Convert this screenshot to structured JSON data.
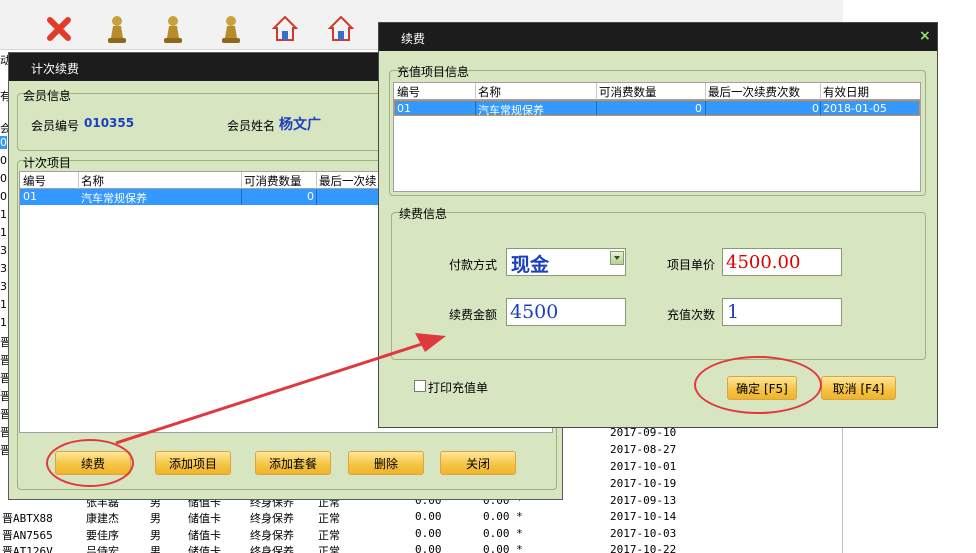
{
  "background": {
    "left_labels": [
      "动",
      "有",
      "会",
      "0",
      "0",
      "0",
      "0",
      "1",
      "1",
      "3",
      "3",
      "3",
      "1",
      "1",
      "晋",
      "晋",
      "晋",
      "晋",
      "晋",
      "晋",
      "晋"
    ],
    "rows": [
      {
        "plate": "晋ABTX88",
        "name": "康建杰",
        "sex": "男",
        "card": "储值卡",
        "plan": "终身保养",
        "status": "正常",
        "v1": "0.00",
        "v2": "0.00 *",
        "date": "2017-10-14"
      },
      {
        "plate": "晋AN7565",
        "name": "要佳序",
        "sex": "男",
        "card": "储值卡",
        "plan": "终身保养",
        "status": "正常",
        "v1": "0.00",
        "v2": "0.00 *",
        "date": "2017-10-03"
      },
      {
        "plate": "晋AT126V",
        "name": "吕侍宏",
        "sex": "男",
        "card": "储值卡",
        "plan": "终身保养",
        "status": "正常",
        "v1": "0.00",
        "v2": "0.00 *",
        "date": "2017-10-22"
      }
    ],
    "dates_right": [
      "2017-09-10",
      "2017-08-27",
      "2017-10-01",
      "2017-10-19",
      "2017-09-13"
    ],
    "partial_row": {
      "name": "张丰磊",
      "sex": "男",
      "card": "储值卡",
      "plan": "终身保养",
      "status": "正常",
      "v1": "0.00",
      "v2": "0.00 *"
    }
  },
  "times_dialog": {
    "title": "计次续费",
    "member_group_label": "会员信息",
    "member_no_label": "会员编号",
    "member_no": "010355",
    "member_name_label": "会员姓名",
    "member_name": "杨文广",
    "items_group_label": "计次项目",
    "columns": [
      "编号",
      "名称",
      "可消费数量",
      "最后一次续"
    ],
    "rows": [
      {
        "id": "01",
        "name": "汽车常规保养",
        "qty": "0",
        "last": ""
      }
    ],
    "buttons": [
      "续费",
      "添加项目",
      "添加套餐",
      "删除",
      "关闭"
    ]
  },
  "renew_dialog": {
    "title": "续费",
    "close_symbol": "×",
    "charge_group_label": "充值项目信息",
    "columns": [
      "编号",
      "名称",
      "可消费数量",
      "最后一次续费次数",
      "有效日期"
    ],
    "rows": [
      {
        "id": "01",
        "name": "汽车常规保养",
        "qty": "0",
        "last": "0",
        "date": "2018-01-05"
      }
    ],
    "renew_group_label": "续费信息",
    "pay_method_label": "付款方式",
    "pay_method": "现金",
    "unit_price_label": "项目单价",
    "unit_price": "4500.00",
    "amount_label": "续费金额",
    "amount": "4500",
    "count_label": "充值次数",
    "count": "1",
    "print_label": "打印充值单",
    "confirm_label": "确定 [F5]",
    "cancel_label": "取消 [F4]"
  },
  "colors": {
    "dialog_bg": "#d8e5c1",
    "title_bar": "#1c1c1c",
    "selection": "#3399ff",
    "button": "#f6c546",
    "annotation": "#e0393d",
    "member_text": "#1b3fbf",
    "price_text": "#e00000"
  }
}
